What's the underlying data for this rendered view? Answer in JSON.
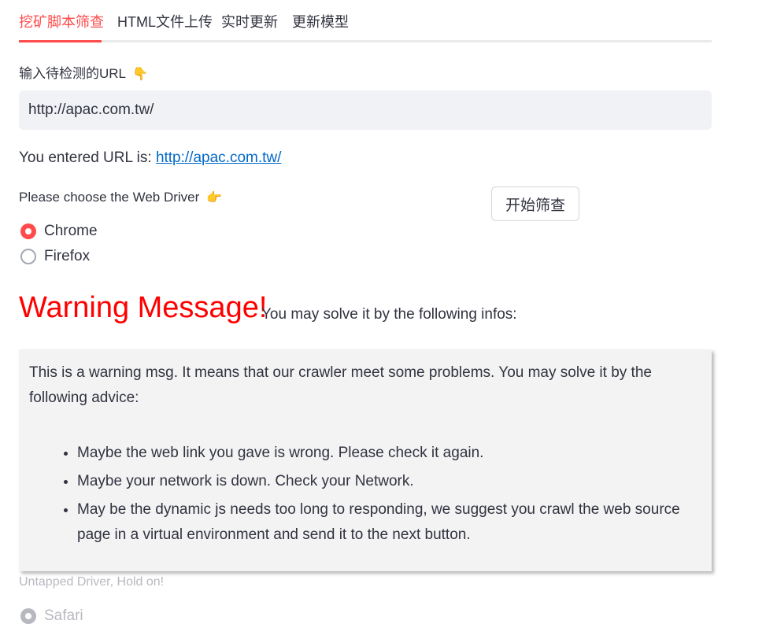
{
  "tabs": [
    {
      "label": "挖矿脚本筛查",
      "active": true
    },
    {
      "label": "HTML文件上传",
      "active": false
    },
    {
      "label": "实时更新",
      "active": false
    },
    {
      "label": "更新模型",
      "active": false
    }
  ],
  "url_field": {
    "label": "输入待检测的URL",
    "label_emoji": "👇",
    "value": "http://apac.com.tw/"
  },
  "entered": {
    "prefix": "You entered URL is:",
    "link": "http://apac.com.tw/"
  },
  "driver": {
    "label": "Please choose the Web Driver",
    "label_emoji": "👉",
    "options": [
      {
        "label": "Chrome",
        "selected": true
      },
      {
        "label": "Firefox",
        "selected": false
      }
    ]
  },
  "start_button": {
    "label": "开始筛查"
  },
  "warning": {
    "title": "Warning Message!",
    "subtitle": "You may solve it by the following infos:",
    "intro": "This is a warning msg. It means that our crawler meet some problems. You may solve it by the following advice:",
    "items": [
      "Maybe the web link you gave is wrong. Please check it again.",
      "Maybe your network is down. Check your Network.",
      "May be the dynamic js needs too long to responding, we suggest you crawl the web source page in a virtual environment and send it to the next button."
    ]
  },
  "untapped": {
    "label": "Untapped Driver, Hold on!",
    "option": "Safari"
  },
  "colors": {
    "accent": "#ff4b4b",
    "warning": "#ff0000",
    "link": "#0068c9",
    "input_bg": "#f0f2f6",
    "box_bg": "#f3f3f4"
  }
}
